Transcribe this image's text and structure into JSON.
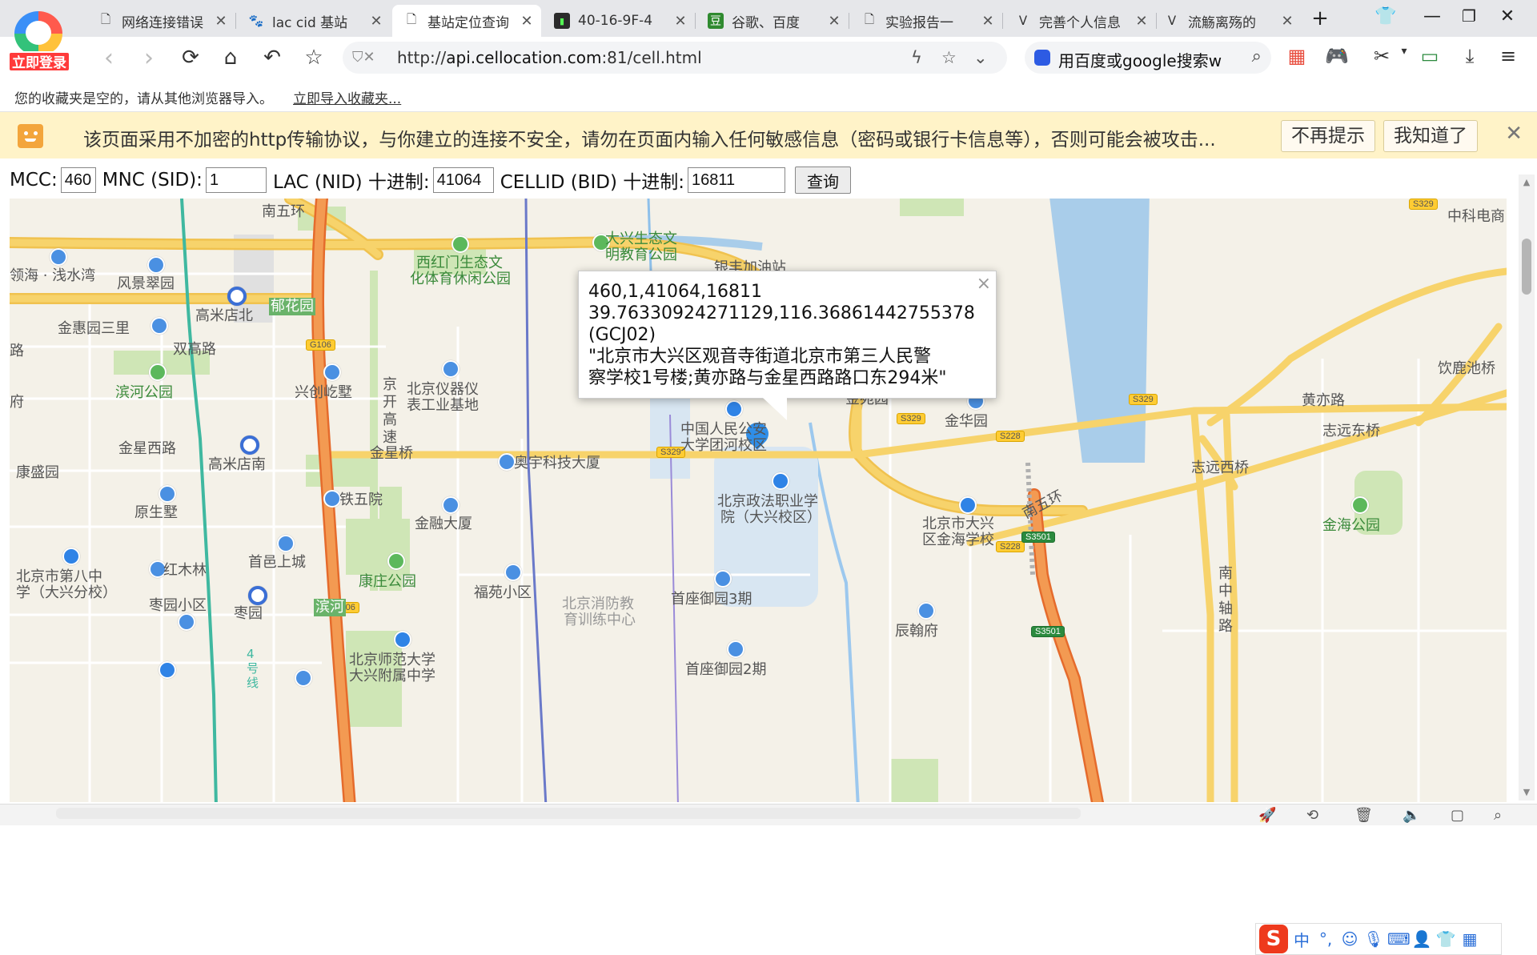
{
  "browser": {
    "login_label": "立即登录",
    "tabs": [
      {
        "title": "网络连接错误",
        "icon": "page-icon"
      },
      {
        "title": "lac cid 基站",
        "icon": "baidu-paw-icon"
      },
      {
        "title": "基站定位查询",
        "icon": "page-icon",
        "active": true
      },
      {
        "title": "40-16-9F-4",
        "icon": "terminal-icon"
      },
      {
        "title": "谷歌、百度",
        "icon": "douban-icon"
      },
      {
        "title": "实验报告一",
        "icon": "page-icon"
      },
      {
        "title": "完善个人信息",
        "icon": "vest-icon"
      },
      {
        "title": "流觞离殇的",
        "icon": "vest-icon"
      }
    ],
    "close_glyph": "✕",
    "new_tab_glyph": "+",
    "address": {
      "protocol": "http://",
      "host": "api.cellocation.com",
      "rest": ":81/cell.html"
    },
    "search_placeholder": "用百度或google搜索w",
    "bookmarks_empty": "您的收藏夹是空的，请从其他浏览器导入。",
    "bookmarks_import": "立即导入收藏夹..."
  },
  "warning": {
    "text": "该页面采用不加密的http传输协议，与你建立的连接不安全，请勿在页面内输入任何敏感信息（密码或银行卡信息等），否则可能会被攻击...",
    "dismiss_forever": "不再提示",
    "acknowledge": "我知道了"
  },
  "form": {
    "mcc_label": "MCC:",
    "mcc_value": "460",
    "mnc_label": "MNC (SID):",
    "mnc_value": "1",
    "lac_label": "LAC (NID) 十进制:",
    "lac_value": "41064",
    "cellid_label": "CELLID (BID) 十进制:",
    "cellid_value": "16811",
    "query_label": "查询"
  },
  "popup": {
    "line1": "460,1,41064,16811",
    "line2": "39.76330924271129,116.36861442755378",
    "line3": "(GCJ02)",
    "line4": "\"北京市大兴区观音寺街道北京市第三人民警",
    "line5": "察学校1号楼;黄亦路与金星西路路口东294米\"",
    "close": "×"
  },
  "map": {
    "labels": {
      "nanwuhuan_top": "南五环",
      "zhongke": "中科电商",
      "dx_eco1": "大兴生态文",
      "dx_eco2": "明教育公园",
      "xihongmen1": "西红门生态文",
      "xihongmen2": "化体育休闲公园",
      "linghai": "领海 · 浅水湾",
      "fengjing": "风景翠园",
      "gaomidian_n": "高米店北",
      "yuhuayuan": "郁花园",
      "jinhui": "金惠园三里",
      "shuanggao": "双高路",
      "lu": "路",
      "binhe": "滨河公园",
      "xingchuang": "兴创屹墅",
      "yiqi1": "北京仪器仪",
      "yiqi2": "表工业基地",
      "jingkai": "京开高速",
      "fu": "府",
      "jinxing_w": "金星西路",
      "gaomidian_s": "高米店南",
      "jinxingqiao": "金星桥",
      "aoyu": "奥宇科技大厦",
      "kangsheng": "康盛园",
      "renda1": "中国人民公安",
      "renda2": "大学团河校区",
      "zhengfa1": "北京政法职业学",
      "zhengfa2": "院（大兴校区）",
      "tiewu": "铁五院",
      "yuansheng": "原生墅",
      "jinrong": "金融大厦",
      "shouyi": "首邑上城",
      "hongmu": "红木林",
      "bj8_1": "北京市第八中",
      "bj8_2": "学（大兴分校）",
      "kangzhuang": "康庄公园",
      "fuyuan": "福苑小区",
      "xiaofang1": "北京消防教",
      "xiaofang2": "育训练中心",
      "shouzuo3": "首座御园3期",
      "zaoyuan_xq": "枣园小区",
      "zaoyuan": "枣园",
      "binhe2": "滨河",
      "shida1": "北京师范大学",
      "shida2": "大兴附属中学",
      "shouzuo2": "首座御园2期",
      "line4": "4号线",
      "jinhuayuan": "金华园",
      "jinyuan": "金苑园",
      "yinlu": "饮鹿池桥",
      "huangyi": "黄亦路",
      "zhiyuan_e": "志远东桥",
      "zhiyuan_w": "志远西桥",
      "nanwuhuan_r": "南五环",
      "jinhai_school1": "北京市大兴",
      "jinhai_school2": "区金海学校",
      "jinhai_park": "金海公园",
      "nanzhong": "南中轴路",
      "chenhan": "辰翰府",
      "yinfeng": "银丰加油站"
    },
    "shields": [
      "G106",
      "G106",
      "S329",
      "S329",
      "S329",
      "S329",
      "S228",
      "S228",
      "S3501",
      "S3501"
    ]
  },
  "colors": {
    "map_bg": "#f4f1e8",
    "road_yellow": "#f7d36b",
    "expressway": "#f39a52",
    "water": "#a9cdea",
    "park": "#cfe6b6",
    "metro": "#3fb8a0",
    "warning_bg": "#fff3c8"
  }
}
